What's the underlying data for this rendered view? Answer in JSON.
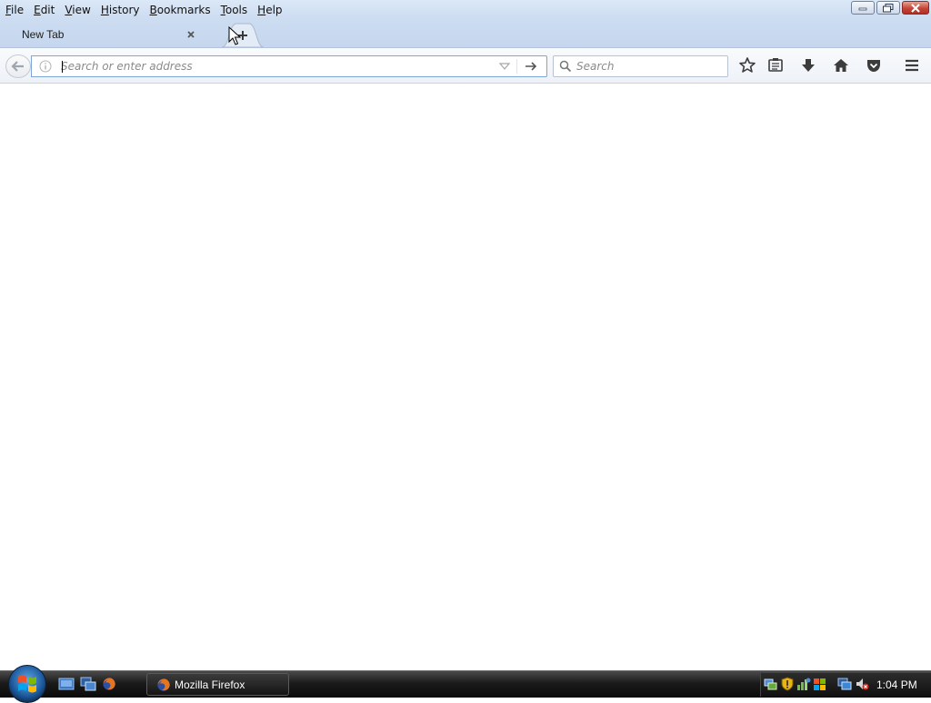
{
  "menu": {
    "items": [
      {
        "label": "File",
        "accel": "F",
        "rest": "ile"
      },
      {
        "label": "Edit",
        "accel": "E",
        "rest": "dit"
      },
      {
        "label": "View",
        "accel": "V",
        "rest": "iew"
      },
      {
        "label": "History",
        "accel": "H",
        "rest": "istory"
      },
      {
        "label": "Bookmarks",
        "accel": "B",
        "rest": "ookmarks"
      },
      {
        "label": "Tools",
        "accel": "T",
        "rest": "ools"
      },
      {
        "label": "Help",
        "accel": "H",
        "rest": "elp"
      }
    ]
  },
  "window_controls": [
    "minimize-icon",
    "restore-icon",
    "close-icon"
  ],
  "tabs": [
    {
      "label": "New Tab",
      "active": true
    }
  ],
  "navbar": {
    "url_placeholder": "Search or enter address",
    "url_value": "",
    "search_placeholder": "Search",
    "toolbar_icons": [
      "bookmark-star-icon",
      "reading-list-icon",
      "downloads-icon",
      "home-icon",
      "pocket-icon",
      "hamburger-menu-icon"
    ]
  },
  "taskbar": {
    "quick_launch": [
      "show-desktop-icon",
      "switch-windows-icon",
      "firefox-icon"
    ],
    "active_task": {
      "label": "Mozilla Firefox"
    },
    "tray_icons": [
      "network-icon",
      "security-shield-icon",
      "network-activity-icon",
      "windows-update-icon",
      "network-connection-icon",
      "volume-muted-icon"
    ],
    "clock": "1:04 PM"
  },
  "colors": {
    "menubar_bg": "#ccdcf1",
    "urlbar_border": "#7aa7d8",
    "taskbar_bg": "#1b1b1b",
    "close_button": "#c5463a"
  }
}
